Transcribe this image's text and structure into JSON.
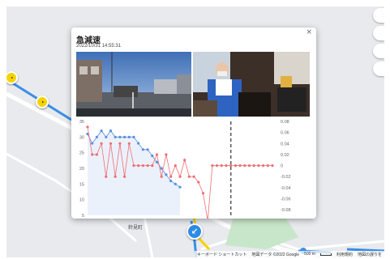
{
  "map": {
    "place_labels": [
      "鈴見町"
    ],
    "attribution": {
      "shortcuts": "キーボード ショートカット",
      "map_data": "地図データ ©2022 Google",
      "scale": "500 m",
      "terms": "利用規約",
      "report": "地図の誤りを"
    },
    "colors": {
      "route": "#3a8ee6",
      "pin": "#f5d300",
      "land": "#e8eaed",
      "water": "#aadaff"
    }
  },
  "popup": {
    "title": "急減速",
    "timestamp": "2022/10/31 14:55:31",
    "close_icon": "×",
    "images": {
      "front": "front-camera-road-view",
      "driver": "driver-camera-cabin-view"
    }
  },
  "chart_data": {
    "type": "line",
    "x": [
      0,
      1,
      2,
      3,
      4,
      5,
      6,
      7,
      8,
      9,
      10,
      11,
      12,
      13,
      14,
      15,
      16,
      17,
      18,
      19,
      20,
      21,
      22,
      23,
      24,
      25,
      26,
      27,
      28,
      29,
      30,
      31,
      32,
      33,
      34,
      35,
      36,
      37,
      38,
      39,
      40
    ],
    "series": [
      {
        "axis": "left",
        "color": "#5b8fdf",
        "values": [
          31,
          28,
          30,
          32,
          30,
          32,
          30,
          30,
          30,
          30,
          30,
          28,
          26,
          26,
          24,
          22,
          20,
          18,
          16,
          15,
          14,
          null,
          null,
          null,
          null,
          null,
          null,
          null,
          null,
          null,
          null,
          null,
          null,
          null,
          null,
          null,
          null,
          null,
          null,
          null,
          null
        ]
      },
      {
        "axis": "right",
        "color": "#ee6f74",
        "values": [
          0.07,
          0.02,
          0.02,
          0.04,
          -0.02,
          0.04,
          -0.02,
          0.04,
          -0.02,
          0.04,
          0,
          0,
          0,
          0,
          0,
          0.02,
          -0.02,
          0.02,
          -0.02,
          0,
          -0.02,
          0.01,
          -0.02,
          -0.02,
          -0.03,
          -0.05,
          -0.1,
          0,
          0,
          0,
          0,
          0,
          0,
          0,
          0,
          0,
          0,
          0,
          0,
          0,
          0
        ]
      }
    ],
    "event_marker_x": 31,
    "left_axis": {
      "ticks": [
        "35",
        "30",
        "25",
        "20",
        "15",
        "10",
        "5"
      ],
      "ylim": [
        5,
        35
      ]
    },
    "right_axis": {
      "ticks": [
        "0.08",
        "0.06",
        "0.04",
        "0.02",
        "0",
        "-0.02",
        "-0.04",
        "-0.06",
        "-0.08"
      ],
      "ylim": [
        -0.09,
        0.08
      ]
    },
    "xlim": [
      0,
      40
    ],
    "grid": false
  }
}
